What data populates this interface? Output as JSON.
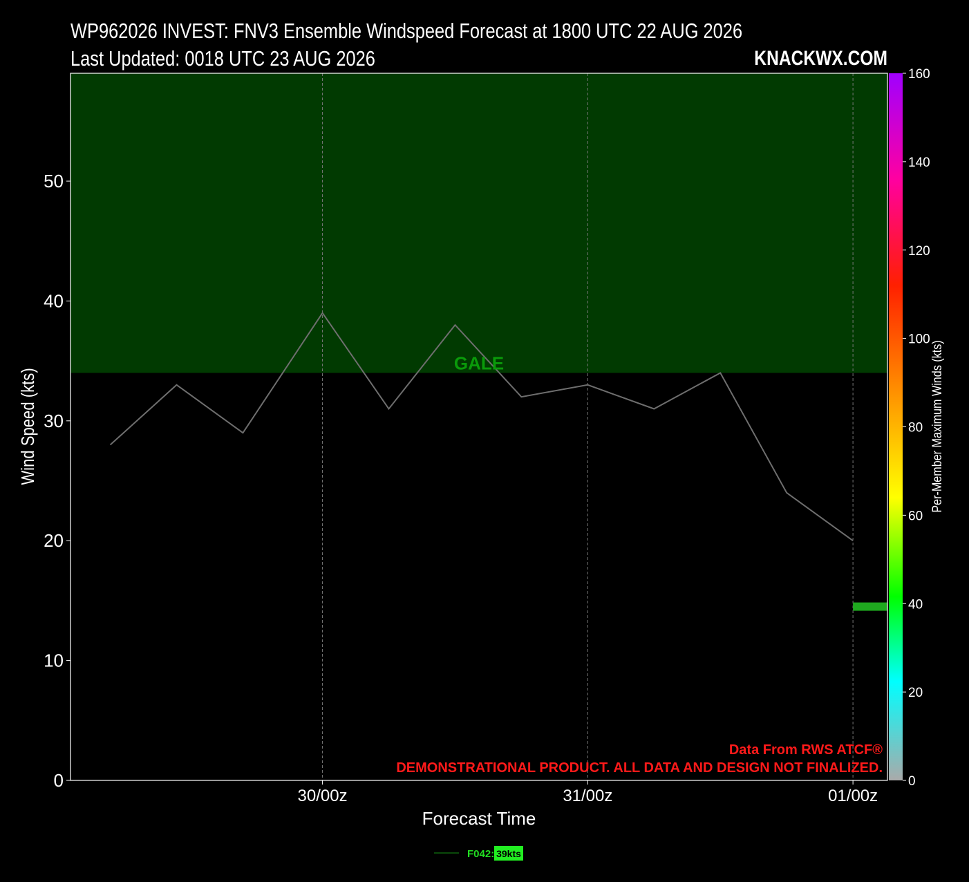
{
  "title_line1": "WP962026 INVEST: FNV3 Ensemble Windspeed Forecast at 1800 UTC 22 AUG 2026",
  "title_line2": "Last Updated: 0018 UTC 23 AUG 2026",
  "brand": "KNACKWX.COM",
  "disclaimer_line1": "Data From RWS ATCF®",
  "disclaimer_line2": "DEMONSTRATIONAL PRODUCT. ALL DATA AND DESIGN NOT FINALIZED.",
  "legend": {
    "label": "F042:",
    "badge": "39kts"
  },
  "colors": {
    "background": "#000000",
    "gale_band": "#013a01",
    "gale_text": "#0a9a0a",
    "member_line": "#6e6e6e",
    "disclaimer": "#ff1a1a",
    "legend_text": "#22dd22",
    "legend_badge": "#22ee22",
    "current_marker": "#1fa81f"
  },
  "chart_data": {
    "type": "line",
    "xlabel": "Forecast Time",
    "ylabel": "Wind Speed (kts)",
    "ylim": [
      0,
      59
    ],
    "yticks": [
      0,
      10,
      20,
      30,
      40,
      50
    ],
    "xlim": [
      -3.5,
      27.3
    ],
    "xticks": [
      {
        "x": 6,
        "label": "30/00z"
      },
      {
        "x": 16,
        "label": "31/00z"
      },
      {
        "x": 26,
        "label": "01/00z"
      }
    ],
    "grid": "vertical dashed at x ticks",
    "series": [
      {
        "x": [
          -2,
          0.5,
          3,
          6,
          8.5,
          11,
          13.5,
          16,
          18.5,
          21,
          23.5,
          26
        ],
        "values": [
          28,
          33,
          29,
          39,
          31,
          38,
          32,
          33,
          31,
          34,
          24,
          20
        ]
      }
    ],
    "annotations": [
      {
        "text": "GALE",
        "band": [
          34,
          59
        ]
      }
    ],
    "current_marker": {
      "x_from": 26,
      "x_to": 27.3,
      "y": 14.5
    },
    "colorbar": {
      "label": "Per-Member Maximum Winds (kts)",
      "range": [
        0,
        160
      ],
      "ticks": [
        0,
        20,
        40,
        60,
        80,
        100,
        120,
        140,
        160
      ],
      "colors": [
        "#aaaaaa",
        "#00ffff",
        "#00ff00",
        "#ffff00",
        "#ff8000",
        "#ff2000",
        "#ff00a0",
        "#a000ff"
      ]
    }
  }
}
